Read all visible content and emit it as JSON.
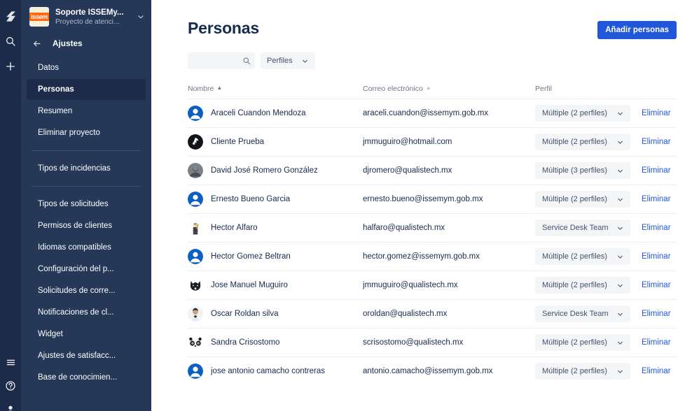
{
  "rail": {
    "top_icons": [
      {
        "name": "jira-logo-icon",
        "label": "Jira"
      },
      {
        "name": "search-icon",
        "label": "Buscar"
      },
      {
        "name": "create-icon",
        "label": "Crear"
      }
    ],
    "bottom_icons": [
      {
        "name": "menu-icon",
        "label": "Menú"
      },
      {
        "name": "help-icon",
        "label": "Ayuda"
      },
      {
        "name": "account-icon",
        "label": "Cuenta"
      }
    ]
  },
  "sidebar": {
    "project": {
      "logo_text": "issem",
      "name": "Soporte ISSEMy...",
      "subtitle": "Proyecto de atenci...",
      "caret": "chevron-down-icon"
    },
    "back": {
      "arrow": "arrow-left-icon",
      "label": "Ajustes"
    },
    "groups": [
      {
        "items": [
          {
            "label": "Datos",
            "selected": false
          },
          {
            "label": "Personas",
            "selected": true
          },
          {
            "label": "Resumen",
            "selected": false
          },
          {
            "label": "Eliminar proyecto",
            "selected": false
          }
        ]
      },
      {
        "items": [
          {
            "label": "Tipos de incidencias",
            "selected": false
          }
        ]
      },
      {
        "items": [
          {
            "label": "Tipos de solicitudes",
            "selected": false
          },
          {
            "label": "Permisos de clientes",
            "selected": false
          },
          {
            "label": "Idiomas compatibles",
            "selected": false
          },
          {
            "label": "Configuración del p...",
            "selected": false
          },
          {
            "label": "Solicitudes de corre...",
            "selected": false
          },
          {
            "label": "Notificaciones de cl...",
            "selected": false
          },
          {
            "label": "Widget",
            "selected": false
          },
          {
            "label": "Ajustes de satisfacc...",
            "selected": false
          },
          {
            "label": "Base de conocimien...",
            "selected": false
          }
        ]
      }
    ]
  },
  "main": {
    "title": "Personas",
    "add_button": "Añadir personas",
    "search": {
      "value": "",
      "placeholder": "",
      "icon": "search-icon"
    },
    "profiles_filter": {
      "label": "Perfiles",
      "icon": "chevron-down-icon"
    },
    "table": {
      "headers": {
        "name": "Nombre",
        "name_sort": "▲",
        "email": "Correo electrónico",
        "email_sort": "▲",
        "profile": "Perfil"
      },
      "rows": [
        {
          "avatar": "default-avatar-blue",
          "name": "Araceli Cuandon Mendoza",
          "email": "araceli.cuandon@issemym.gob.mx",
          "profile": "Múltiple (2 perfiles)",
          "delete": "Eliminar"
        },
        {
          "avatar": "dark-logo-avatar",
          "name": "Cliente Prueba",
          "email": "jmmuguiro@hotmail.com",
          "profile": "Múltiple (2 perfiles)",
          "delete": "Eliminar"
        },
        {
          "avatar": "photo-avatar-grey",
          "name": "David José Romero González",
          "email": "djromero@qualistech.mx",
          "profile": "Múltiple (3 perfiles)",
          "delete": "Eliminar"
        },
        {
          "avatar": "default-avatar-blue",
          "name": "Ernesto Bueno Garcia",
          "email": "ernesto.bueno@issemym.gob.mx",
          "profile": "Múltiple (2 perfiles)",
          "delete": "Eliminar"
        },
        {
          "avatar": "character-avatar",
          "name": "Hector Alfaro",
          "email": "halfaro@qualistech.mx",
          "profile": "Service Desk Team",
          "delete": "Eliminar"
        },
        {
          "avatar": "default-avatar-blue",
          "name": "Hector Gomez Beltran",
          "email": "hector.gomez@issemym.gob.mx",
          "profile": "Múltiple (2 perfiles)",
          "delete": "Eliminar"
        },
        {
          "avatar": "wolf-avatar",
          "name": "Jose Manuel Muguiro",
          "email": "jmmuguiro@qualistech.mx",
          "profile": "Múltiple (2 perfiles)",
          "delete": "Eliminar"
        },
        {
          "avatar": "person-avatar",
          "name": "Oscar Roldan silva",
          "email": "oroldan@qualistech.mx",
          "profile": "Service Desk Team",
          "delete": "Eliminar"
        },
        {
          "avatar": "panda-avatar",
          "name": "Sandra Crisostomo",
          "email": "scrisostomo@qualistech.mx",
          "profile": "Múltiple (2 perfiles)",
          "delete": "Eliminar"
        },
        {
          "avatar": "default-avatar-blue",
          "name": "jose antonio camacho contreras",
          "email": "antonio.camacho@issemym.gob.mx",
          "profile": "Múltiple (2 perfiles)",
          "delete": "Eliminar"
        }
      ]
    }
  },
  "colors": {
    "rail_bg": "#1c2b4a",
    "sidebar_bg": "#253858",
    "sidebar_selected": "#1c2b4a",
    "primary_button": "#2057d8",
    "link": "#2057d8",
    "text_dark": "#172b4d",
    "text_muted": "#6b778c",
    "pill_bg": "#f4f5f7"
  }
}
